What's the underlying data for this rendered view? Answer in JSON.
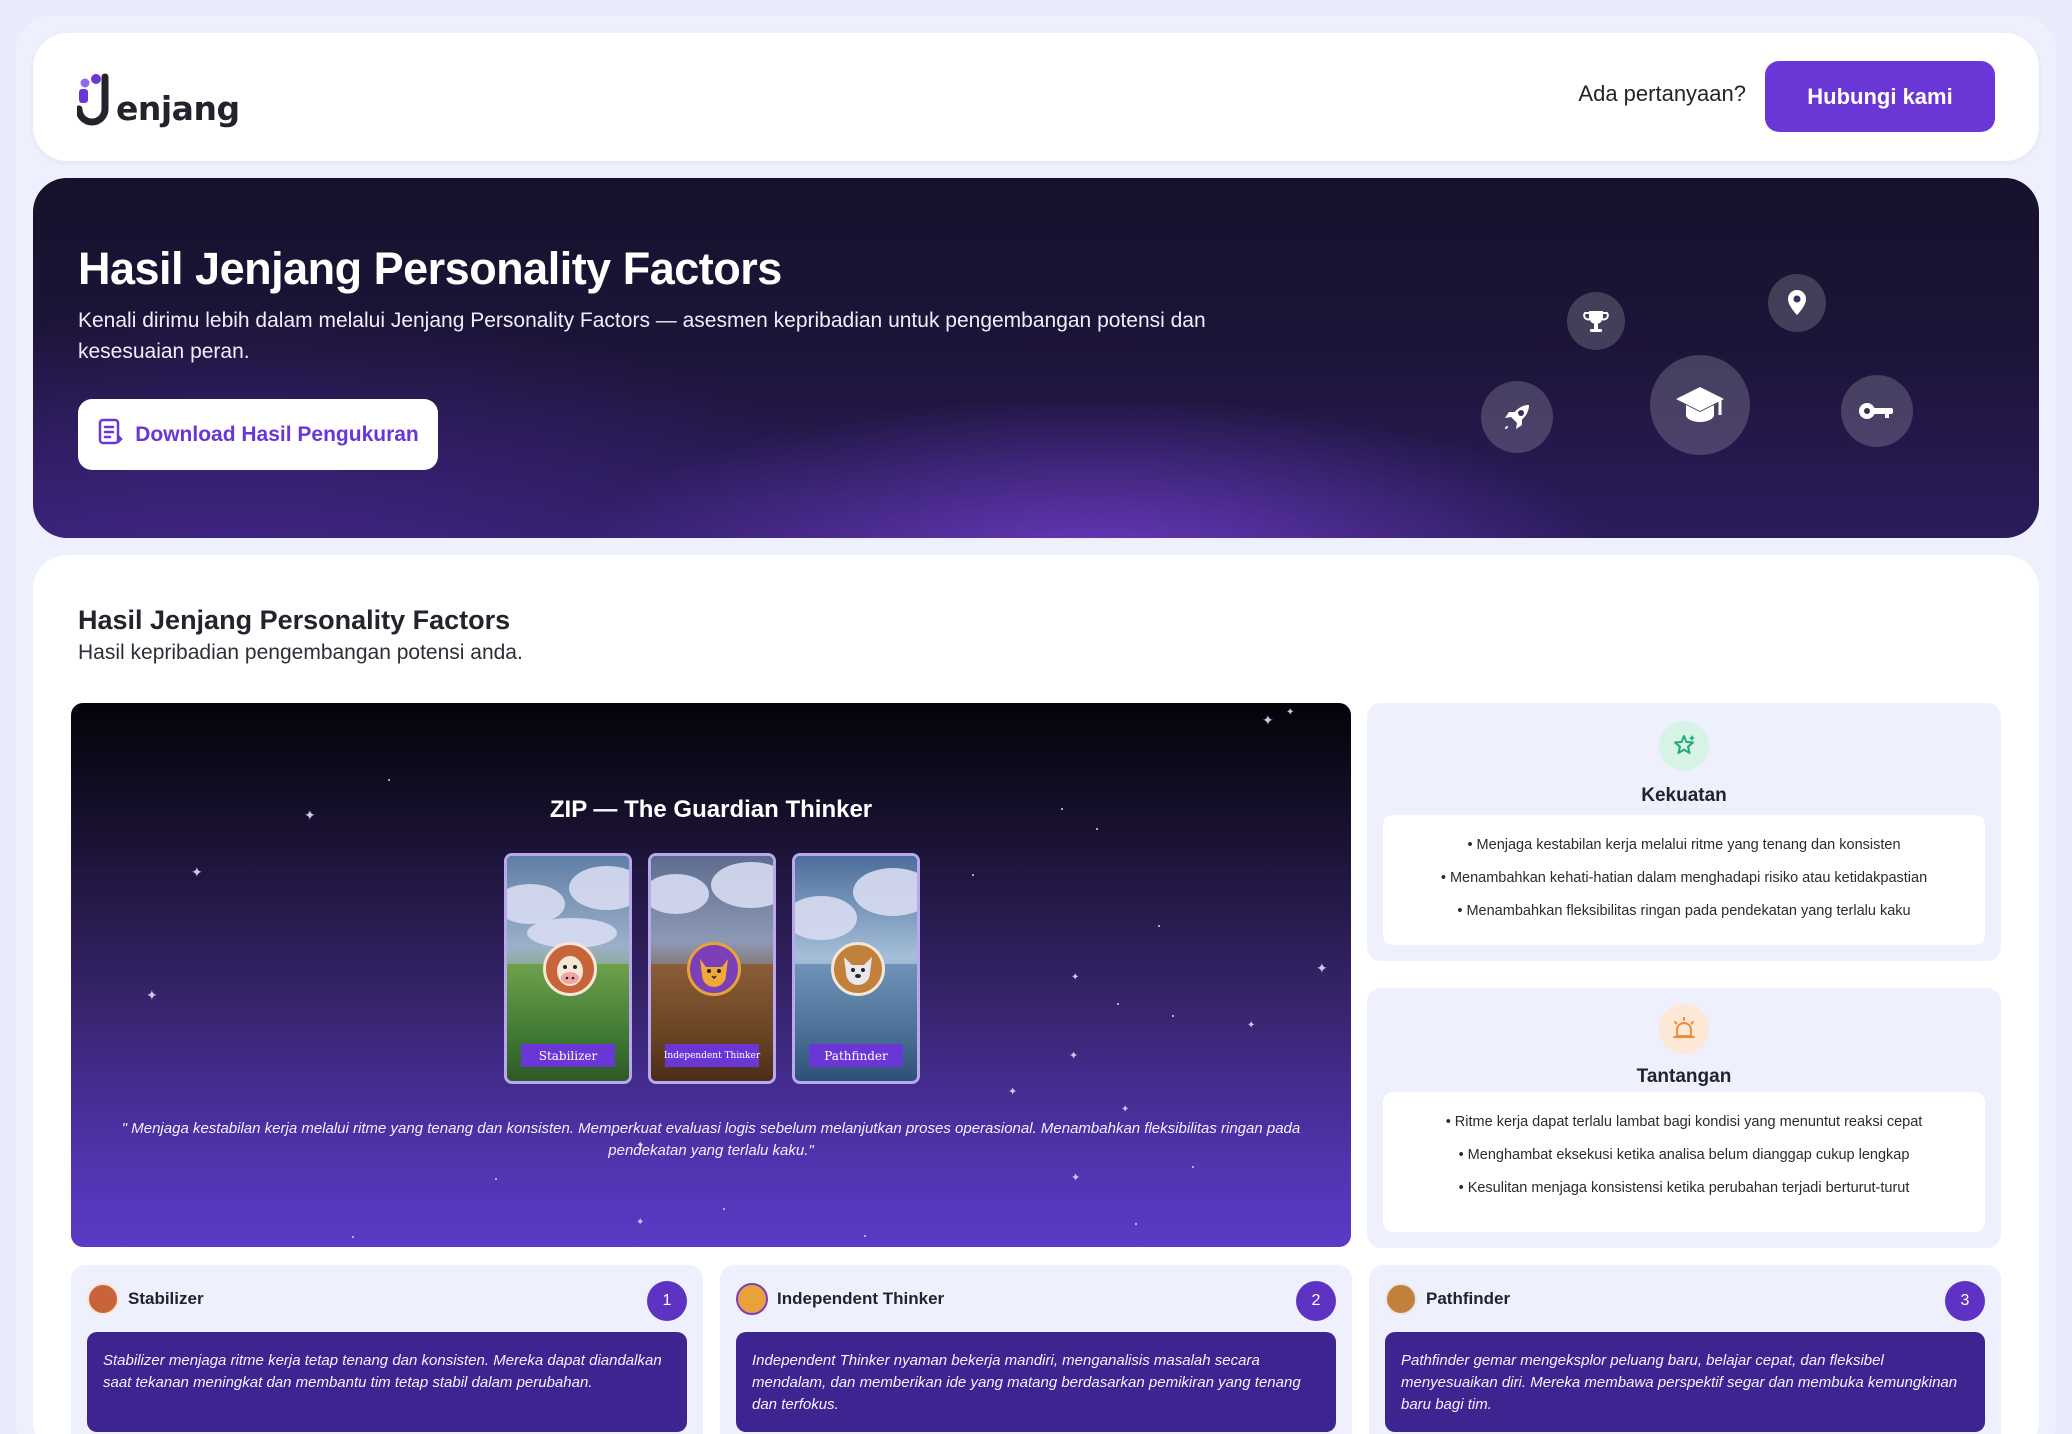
{
  "header": {
    "logo_text": "enjang",
    "question": "Ada pertanyaan?",
    "contact_button": "Hubungi kami"
  },
  "hero": {
    "title": "Hasil Jenjang Personality Factors",
    "subtitle": "Kenali dirimu lebih dalam melalui Jenjang Personality Factors — asesmen kepribadian untuk pengembangan potensi dan kesesuaian peran.",
    "download_button": "Download Hasil Pengukuran",
    "icons": [
      "trophy-icon",
      "location-pin-icon",
      "rocket-icon",
      "graduation-cap-icon",
      "key-icon"
    ]
  },
  "result": {
    "title": "Hasil Jenjang Personality Factors",
    "subtitle": "Hasil kepribadian pengembangan potensi anda.",
    "scene": {
      "title": "ZIP — The Guardian Thinker",
      "cards": [
        "Stabilizer",
        "Independent Thinker",
        "Pathfinder"
      ],
      "quote": "\" Menjaga kestabilan kerja melalui ritme yang tenang dan konsisten. Memperkuat evaluasi logis sebelum melanjutkan proses operasional. Menambahkan fleksibilitas ringan pada pendekatan yang terlalu kaku.\""
    },
    "strengths": {
      "title": "Kekuatan",
      "items": [
        "• Menjaga kestabilan kerja melalui ritme yang tenang dan konsisten",
        "• Menambahkan kehati-hatian dalam menghadapi risiko atau ketidakpastian",
        "• Menambahkan fleksibilitas ringan pada pendekatan yang terlalu kaku"
      ]
    },
    "challenges": {
      "title": "Tantangan",
      "items": [
        "• Ritme kerja dapat terlalu lambat bagi kondisi yang menuntut reaksi cepat",
        "• Menghambat eksekusi ketika analisa belum dianggap cukup lengkap",
        "• Kesulitan menjaga konsistensi ketika perubahan terjadi berturut-turut"
      ]
    },
    "personas": [
      {
        "name": "Stabilizer",
        "rank": "1",
        "description": "Stabilizer menjaga ritme kerja tetap tenang dan konsisten. Mereka dapat diandalkan saat tekanan meningkat dan membantu tim tetap stabil dalam perubahan."
      },
      {
        "name": "Independent Thinker",
        "rank": "2",
        "description": "Independent Thinker nyaman bekerja mandiri, menganalisis masalah secara mendalam, dan memberikan ide yang matang berdasarkan pemikiran yang tenang dan terfokus."
      },
      {
        "name": "Pathfinder",
        "rank": "3",
        "description": "Pathfinder gemar mengeksplor peluang baru, belajar cepat, dan fleksibel menyesuaikan diri. Mereka membawa perspektif segar dan membuka kemungkinan baru bagi tim."
      }
    ]
  },
  "colors": {
    "accent": "#6a36d6",
    "hero_dark": "#1c1437",
    "panel_bg": "#eef0fd",
    "strength_icon": "#1faa7a",
    "challenge_icon": "#f08a3c"
  }
}
